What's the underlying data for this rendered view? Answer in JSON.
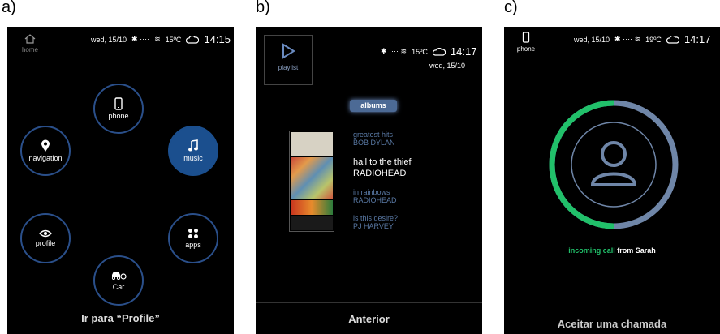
{
  "panels": [
    {
      "label": "a)"
    },
    {
      "label": "b)"
    },
    {
      "label": "c)"
    }
  ],
  "panel_a": {
    "home_label": "home",
    "date": "wed, 15/10",
    "temp": "15ºC",
    "time": "14:15",
    "menu": {
      "phone": "phone",
      "navigation": "navigation",
      "music": "music",
      "profile": "profile",
      "apps": "apps",
      "car": "Car"
    },
    "bottom": "Ir para “Profile”"
  },
  "panel_b": {
    "playlist_label": "playlist",
    "temp": "15ºC",
    "time": "14:17",
    "date": "wed, 15/10",
    "albums_button": "albums",
    "albums": [
      {
        "title": "greatest hits",
        "artist": "BOB DYLAN"
      },
      {
        "title": "hail to the thief",
        "artist": "RADIOHEAD"
      },
      {
        "title": "in rainbows",
        "artist": "RADIOHEAD"
      },
      {
        "title": "is this desire?",
        "artist": "PJ HARVEY"
      }
    ],
    "bottom": "Anterior"
  },
  "panel_c": {
    "phone_label": "phone",
    "date": "wed, 15/10",
    "temp": "19ºC",
    "time": "14:17",
    "incoming": "incoming call",
    "from": "from Sarah",
    "bottom": "Aceitar uma chamada"
  },
  "colors": {
    "accent_blue": "#1b4f8e",
    "ring_blue": "#2a4f8a",
    "call_green": "#21c06a",
    "ring_grey": "#6f86a8"
  }
}
